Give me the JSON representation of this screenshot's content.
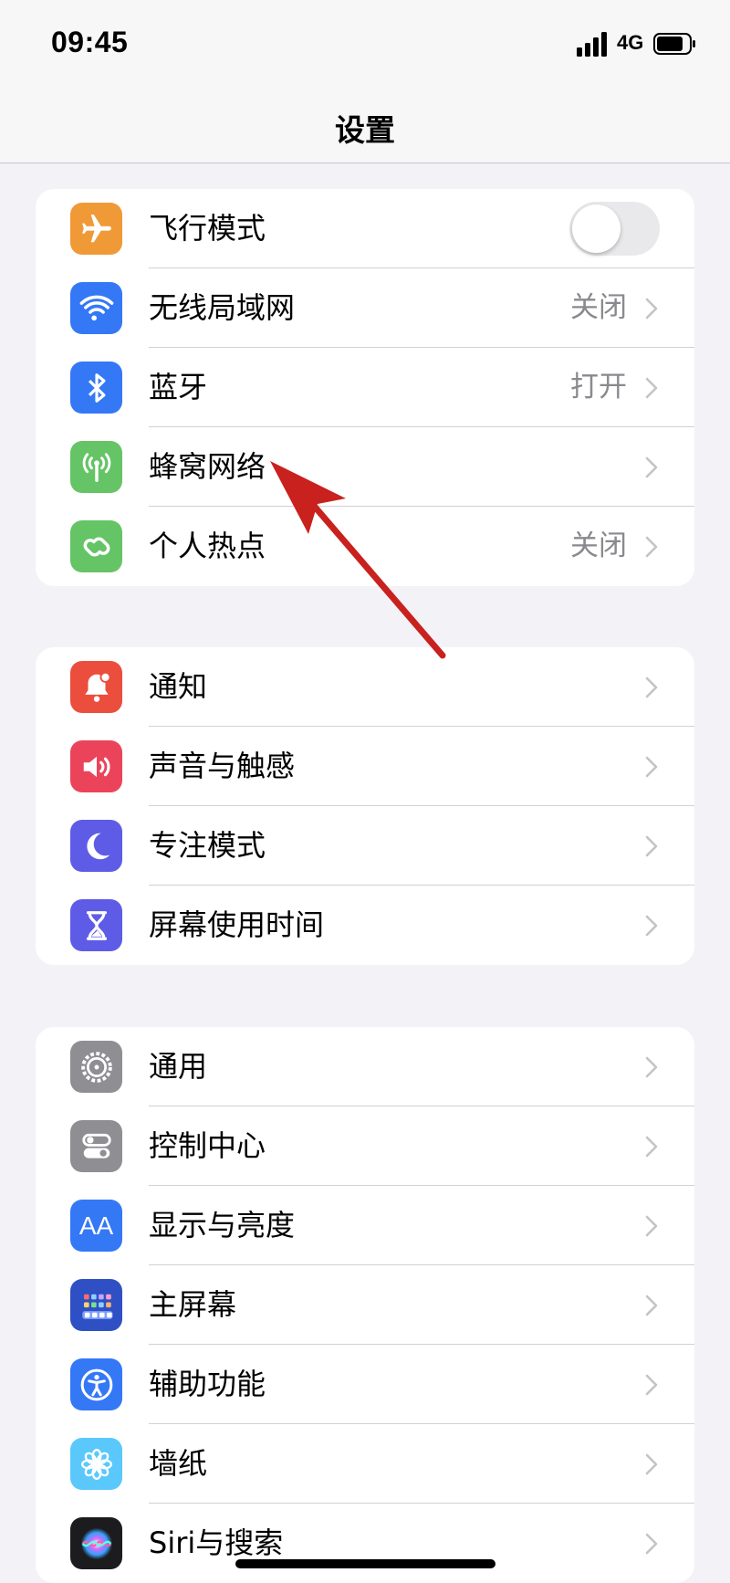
{
  "status_bar": {
    "time": "09:45",
    "network": "4G",
    "signal_icon": "cellular-signal-icon",
    "battery_icon": "battery-icon"
  },
  "header": {
    "title": "设置"
  },
  "groups": [
    {
      "items": [
        {
          "label": "飞行模式",
          "value": "",
          "control": "toggle",
          "toggle_on": false,
          "icon": "airplane-icon",
          "color": "#f09a37"
        },
        {
          "label": "无线局域网",
          "value": "关闭",
          "control": "chevron",
          "icon": "wifi-icon",
          "color": "#3478f6"
        },
        {
          "label": "蓝牙",
          "value": "打开",
          "control": "chevron",
          "icon": "bluetooth-icon",
          "color": "#3478f6"
        },
        {
          "label": "蜂窝网络",
          "value": "",
          "control": "chevron",
          "icon": "antenna-icon",
          "color": "#65c466"
        },
        {
          "label": "个人热点",
          "value": "关闭",
          "control": "chevron",
          "icon": "hotspot-icon",
          "color": "#65c466"
        }
      ]
    },
    {
      "items": [
        {
          "label": "通知",
          "value": "",
          "control": "chevron",
          "icon": "notification-bell-icon",
          "color": "#eb4e3d"
        },
        {
          "label": "声音与触感",
          "value": "",
          "control": "chevron",
          "icon": "speaker-icon",
          "color": "#eb445a"
        },
        {
          "label": "专注模式",
          "value": "",
          "control": "chevron",
          "icon": "moon-icon",
          "color": "#5e5ce6"
        },
        {
          "label": "屏幕使用时间",
          "value": "",
          "control": "chevron",
          "icon": "hourglass-icon",
          "color": "#5e5ce6"
        }
      ]
    },
    {
      "items": [
        {
          "label": "通用",
          "value": "",
          "control": "chevron",
          "icon": "gear-icon",
          "color": "#8e8e93"
        },
        {
          "label": "控制中心",
          "value": "",
          "control": "chevron",
          "icon": "toggles-icon",
          "color": "#8e8e93"
        },
        {
          "label": "显示与亮度",
          "value": "",
          "control": "chevron",
          "icon": "text-size-icon",
          "color": "#3478f6",
          "icon_text": "AA"
        },
        {
          "label": "主屏幕",
          "value": "",
          "control": "chevron",
          "icon": "home-screen-grid-icon",
          "color": "#2f50c4"
        },
        {
          "label": "辅助功能",
          "value": "",
          "control": "chevron",
          "icon": "accessibility-icon",
          "color": "#3478f6"
        },
        {
          "label": "墙纸",
          "value": "",
          "control": "chevron",
          "icon": "flower-icon",
          "color": "#5ac8fa"
        },
        {
          "label": "Siri与搜索",
          "value": "",
          "control": "chevron",
          "icon": "siri-icon",
          "color": "#1c1c1e"
        }
      ]
    }
  ],
  "annotation": {
    "icon": "red-arrow-annotation",
    "color": "#c8211e",
    "points_to": "蜂窝网络"
  }
}
